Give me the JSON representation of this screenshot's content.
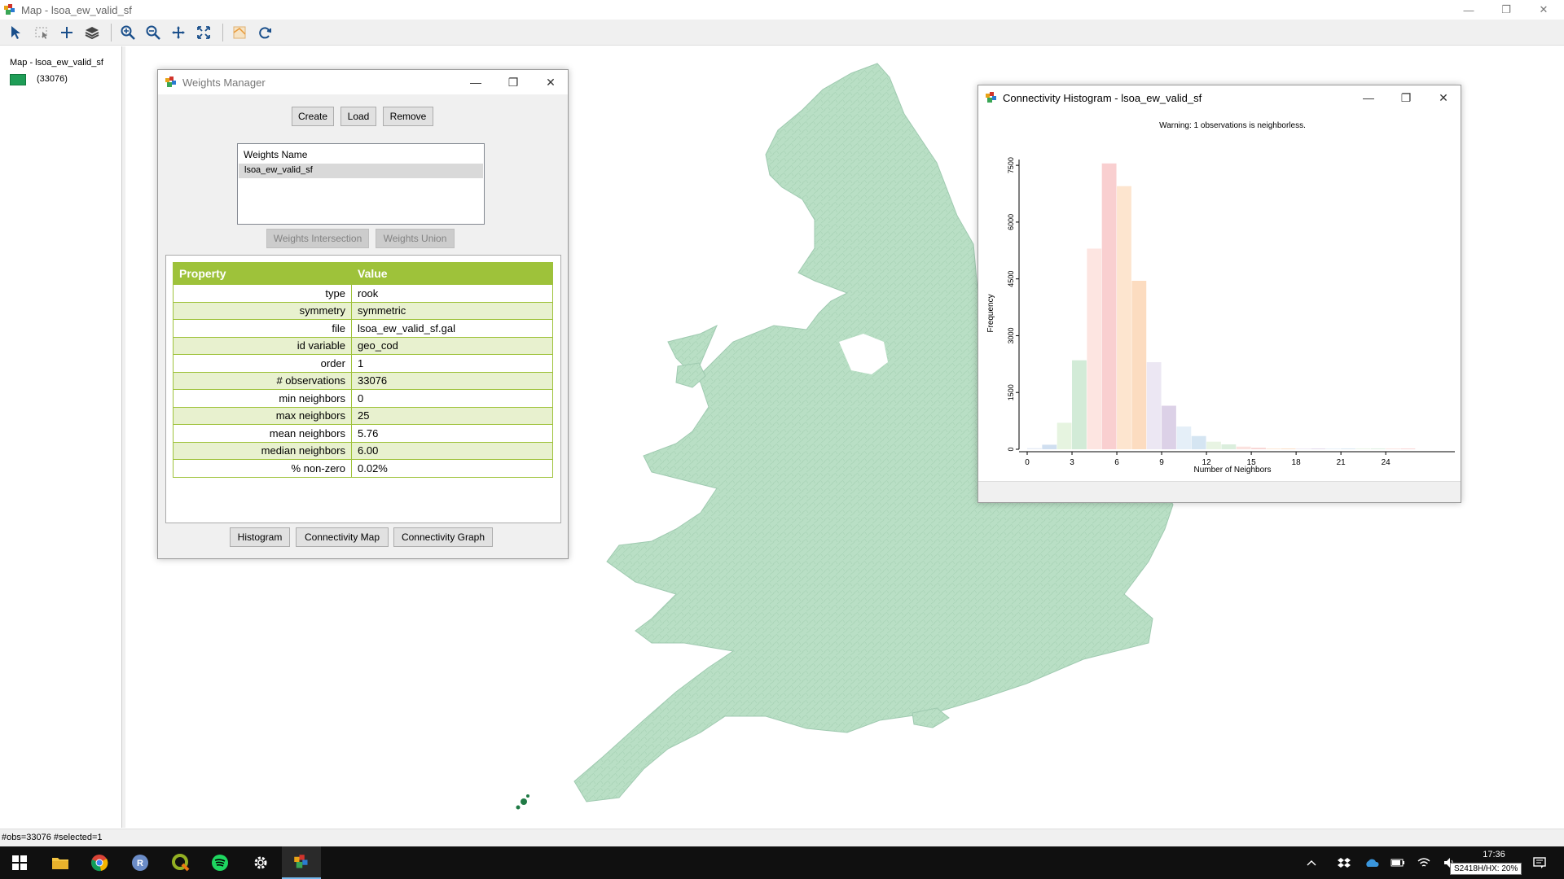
{
  "window": {
    "title": "Map - lsoa_ew_valid_sf",
    "minimize": "—",
    "restore": "❐",
    "close": "✕"
  },
  "toolbar": {
    "icons": [
      "select-pointer-icon",
      "select-rect-icon",
      "add-icon",
      "layers-icon",
      "zoom-in-icon",
      "zoom-out-icon",
      "pan-icon",
      "full-extent-icon",
      "basemap-icon",
      "refresh-icon"
    ]
  },
  "legend": {
    "title": "Map - lsoa_ew_valid_sf",
    "count": "(33076)",
    "swatch_color": "#1f9d57"
  },
  "map": {
    "fill_color": "#b8dec4",
    "selected_color": "#1f7a45"
  },
  "status": {
    "text": "#obs=33076 #selected=1"
  },
  "weights_manager": {
    "title": "Weights Manager",
    "buttons": {
      "create": "Create",
      "load": "Load",
      "remove": "Remove"
    },
    "list_header": "Weights Name",
    "list_items": [
      "lsoa_ew_valid_sf"
    ],
    "intersection": "Weights Intersection",
    "union": "Weights Union",
    "table_headers": {
      "property": "Property",
      "value": "Value"
    },
    "properties": [
      {
        "key": "type",
        "value": "rook"
      },
      {
        "key": "symmetry",
        "value": "symmetric"
      },
      {
        "key": "file",
        "value": "lsoa_ew_valid_sf.gal"
      },
      {
        "key": "id variable",
        "value": "geo_cod"
      },
      {
        "key": "order",
        "value": "1"
      },
      {
        "key": "# observations",
        "value": "33076"
      },
      {
        "key": "min neighbors",
        "value": "0"
      },
      {
        "key": "max neighbors",
        "value": "25"
      },
      {
        "key": "mean neighbors",
        "value": "5.76"
      },
      {
        "key": "median neighbors",
        "value": "6.00"
      },
      {
        "key": "% non-zero",
        "value": "0.02%"
      }
    ],
    "bottom_buttons": {
      "histogram": "Histogram",
      "connectivity_map": "Connectivity Map",
      "connectivity_graph": "Connectivity Graph"
    }
  },
  "histogram_window": {
    "title": "Connectivity Histogram - lsoa_ew_valid_sf",
    "warning": "Warning: 1 observations is neighborless."
  },
  "chart_data": {
    "type": "bar",
    "title": "",
    "xlabel": "Number of Neighbors",
    "ylabel": "Frequency",
    "xlim": [
      0,
      26
    ],
    "ylim": [
      0,
      7500
    ],
    "xticks": [
      "0",
      "3",
      "6",
      "9",
      "12",
      "15",
      "18",
      "21",
      "24"
    ],
    "yticks": [
      "0",
      "1500",
      "3000",
      "4500",
      "6000",
      "7500"
    ],
    "bins": [
      {
        "x0": 0,
        "x1": 1,
        "value": 30,
        "color": "#e6ecf5"
      },
      {
        "x0": 1,
        "x1": 2,
        "value": 120,
        "color": "#d0dff0"
      },
      {
        "x0": 2,
        "x1": 3,
        "value": 700,
        "color": "#e6f4e0"
      },
      {
        "x0": 3,
        "x1": 4,
        "value": 2350,
        "color": "#d2ebd7"
      },
      {
        "x0": 4,
        "x1": 5,
        "value": 5300,
        "color": "#fde5e1"
      },
      {
        "x0": 5,
        "x1": 6,
        "value": 7550,
        "color": "#f9cfd0"
      },
      {
        "x0": 6,
        "x1": 7,
        "value": 6950,
        "color": "#fde5cf"
      },
      {
        "x0": 7,
        "x1": 8,
        "value": 4450,
        "color": "#fcdcc0"
      },
      {
        "x0": 8,
        "x1": 9,
        "value": 2300,
        "color": "#ece7f3"
      },
      {
        "x0": 9,
        "x1": 10,
        "value": 1150,
        "color": "#dcd1e7"
      },
      {
        "x0": 10,
        "x1": 11,
        "value": 600,
        "color": "#e5eff8"
      },
      {
        "x0": 11,
        "x1": 12,
        "value": 350,
        "color": "#d5e5f2"
      },
      {
        "x0": 12,
        "x1": 13,
        "value": 200,
        "color": "#e8f4e3"
      },
      {
        "x0": 13,
        "x1": 14,
        "value": 130,
        "color": "#dbeedd"
      },
      {
        "x0": 14,
        "x1": 15,
        "value": 70,
        "color": "#fbe2df"
      },
      {
        "x0": 15,
        "x1": 16,
        "value": 40,
        "color": "#f8d4d3"
      },
      {
        "x0": 16,
        "x1": 17,
        "value": 20,
        "color": "#fde8d6"
      },
      {
        "x0": 17,
        "x1": 18,
        "value": 12,
        "color": "#fcdfc8"
      },
      {
        "x0": 18,
        "x1": 19,
        "value": 8,
        "color": "#eeeaf4"
      },
      {
        "x0": 19,
        "x1": 20,
        "value": 5,
        "color": "#e2d9ec"
      },
      {
        "x0": 20,
        "x1": 21,
        "value": 4,
        "color": "#e7f0f8"
      },
      {
        "x0": 21,
        "x1": 22,
        "value": 3,
        "color": "#d9e7f3"
      },
      {
        "x0": 22,
        "x1": 23,
        "value": 2,
        "color": "#eaf5e6"
      },
      {
        "x0": 23,
        "x1": 24,
        "value": 2,
        "color": "#ddefe0"
      },
      {
        "x0": 24,
        "x1": 25,
        "value": 1,
        "color": "#fbe4e1"
      },
      {
        "x0": 25,
        "x1": 26,
        "value": 1,
        "color": "#f9d6d5"
      }
    ]
  },
  "taskbar": {
    "apps": [
      "windows-start-icon",
      "file-explorer-icon",
      "chrome-icon",
      "r-icon",
      "qgis-icon",
      "spotify-icon",
      "settings-icon",
      "geoda-icon"
    ],
    "tray": [
      "chevron-up-icon",
      "dropbox-icon",
      "onedrive-icon",
      "battery-icon",
      "wifi-icon",
      "volume-icon"
    ],
    "time": "17:36",
    "tooltip": "S2418H/HX: 20%",
    "notification": "notification-icon"
  }
}
